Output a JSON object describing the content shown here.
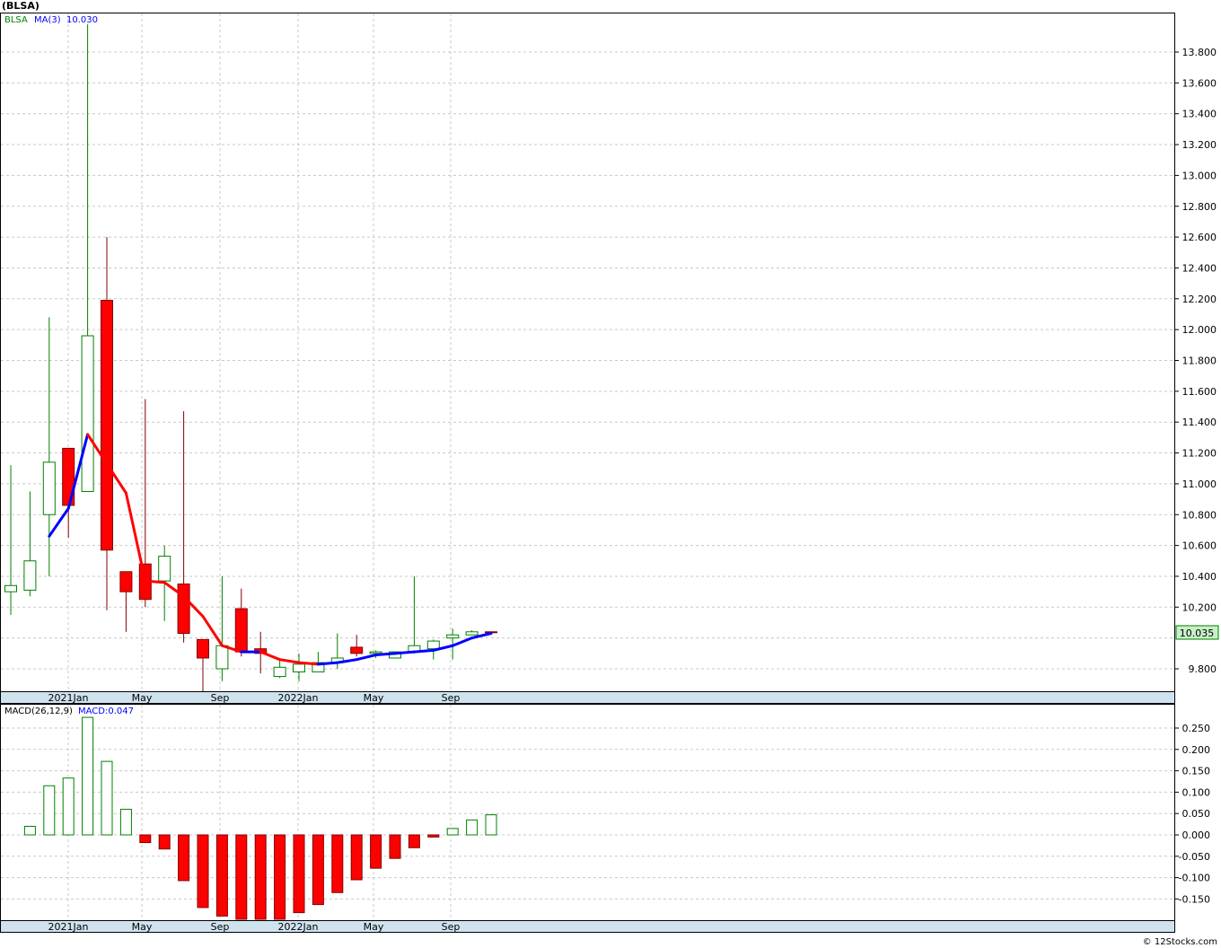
{
  "title": "(BLSA)",
  "footer": "© 12Stocks.com",
  "price_panel": {
    "legend_symbol": "BLSA",
    "legend_ma": "MA(3)",
    "legend_ma_value": "10.030",
    "last_price_label": "10.035",
    "yticks": [
      "13.800",
      "13.600",
      "13.400",
      "13.200",
      "13.000",
      "12.800",
      "12.600",
      "12.400",
      "12.200",
      "12.000",
      "11.800",
      "11.600",
      "11.400",
      "11.200",
      "11.000",
      "10.800",
      "10.600",
      "10.400",
      "10.200",
      "9.800"
    ],
    "xticks": [
      "2021Jan",
      "May",
      "Sep",
      "2022Jan",
      "May",
      "Sep"
    ]
  },
  "macd_panel": {
    "legend_name": "MACD(26,12,9)",
    "legend_value": "MACD:0.047",
    "yticks": [
      "0.250",
      "0.200",
      "0.150",
      "0.100",
      "0.050",
      "0.000",
      "-0.050",
      "-0.100",
      "-0.150"
    ],
    "xticks": [
      "2021Jan",
      "May",
      "Sep",
      "2022Jan",
      "May",
      "Sep"
    ]
  },
  "colors": {
    "up": "#008000",
    "down": "#ff0000",
    "ma_up": "#0000ff",
    "ma_down": "#ff0000",
    "axis_band": "#cfe3ef",
    "grid": "#c8c8c8",
    "last_price_bg": "#c8f0c8"
  },
  "chart_data": [
    {
      "type": "candlestick",
      "title": "(BLSA)",
      "ylim": [
        9.6,
        14.0
      ],
      "x_axis_labels": [
        "2021Jan",
        "May",
        "Sep",
        "2022Jan",
        "May",
        "Sep"
      ],
      "series": [
        {
          "name": "BLSA",
          "candles": [
            {
              "o": 10.3,
              "h": 11.12,
              "l": 10.15,
              "c": 10.34
            },
            {
              "o": 10.31,
              "h": 10.95,
              "l": 10.27,
              "c": 10.5
            },
            {
              "o": 10.8,
              "h": 12.08,
              "l": 10.4,
              "c": 11.14
            },
            {
              "o": 11.23,
              "h": 11.23,
              "l": 10.65,
              "c": 10.86
            },
            {
              "o": 10.95,
              "h": 13.98,
              "l": 10.95,
              "c": 11.96
            },
            {
              "o": 12.19,
              "h": 12.6,
              "l": 10.18,
              "c": 10.57
            },
            {
              "o": 10.43,
              "h": 10.43,
              "l": 10.04,
              "c": 10.3
            },
            {
              "o": 10.48,
              "h": 11.55,
              "l": 10.2,
              "c": 10.25
            },
            {
              "o": 10.37,
              "h": 10.6,
              "l": 10.11,
              "c": 10.53
            },
            {
              "o": 10.35,
              "h": 11.47,
              "l": 9.97,
              "c": 10.03
            },
            {
              "o": 9.99,
              "h": 9.99,
              "l": 9.62,
              "c": 9.87
            },
            {
              "o": 9.8,
              "h": 10.4,
              "l": 9.72,
              "c": 9.95
            },
            {
              "o": 10.19,
              "h": 10.32,
              "l": 9.88,
              "c": 9.91
            },
            {
              "o": 9.93,
              "h": 10.04,
              "l": 9.77,
              "c": 9.9
            },
            {
              "o": 9.75,
              "h": 9.85,
              "l": 9.74,
              "c": 9.81
            },
            {
              "o": 9.78,
              "h": 9.9,
              "l": 9.72,
              "c": 9.83
            },
            {
              "o": 9.78,
              "h": 9.91,
              "l": 9.78,
              "c": 9.84
            },
            {
              "o": 9.84,
              "h": 10.03,
              "l": 9.8,
              "c": 9.87
            },
            {
              "o": 9.94,
              "h": 10.02,
              "l": 9.88,
              "c": 9.9
            },
            {
              "o": 9.9,
              "h": 9.92,
              "l": 9.87,
              "c": 9.91
            },
            {
              "o": 9.87,
              "h": 9.9,
              "l": 9.87,
              "c": 9.91
            },
            {
              "o": 9.91,
              "h": 10.4,
              "l": 9.9,
              "c": 9.95
            },
            {
              "o": 9.93,
              "h": 9.99,
              "l": 9.86,
              "c": 9.98
            },
            {
              "o": 10.0,
              "h": 10.06,
              "l": 9.86,
              "c": 10.02
            },
            {
              "o": 10.02,
              "h": 10.05,
              "l": 10.02,
              "c": 10.04
            },
            {
              "o": 10.04,
              "h": 10.04,
              "l": 10.03,
              "c": 10.035
            }
          ]
        },
        {
          "name": "MA(3)",
          "values": [
            null,
            null,
            10.66,
            10.84,
            11.32,
            11.13,
            10.94,
            10.37,
            10.36,
            10.27,
            10.14,
            9.95,
            9.91,
            9.91,
            9.86,
            9.84,
            9.83,
            9.84,
            9.86,
            9.89,
            9.9,
            9.91,
            9.92,
            9.95,
            10.0,
            10.03
          ]
        }
      ]
    },
    {
      "type": "bar",
      "title": "MACD(26,12,9)",
      "ylim": [
        -0.2,
        0.275
      ],
      "x_axis_labels": [
        "2021Jan",
        "May",
        "Sep",
        "2022Jan",
        "May",
        "Sep"
      ],
      "series": [
        {
          "name": "MACD(26,12,9)",
          "values": [
            0.02,
            0.115,
            0.133,
            0.275,
            0.172,
            0.06,
            -0.018,
            -0.033,
            -0.107,
            -0.17,
            -0.19,
            -0.2,
            -0.2,
            -0.2,
            -0.182,
            -0.163,
            -0.135,
            -0.105,
            -0.078,
            -0.055,
            -0.03,
            -0.005,
            0.015,
            0.035,
            0.047
          ]
        }
      ]
    }
  ]
}
